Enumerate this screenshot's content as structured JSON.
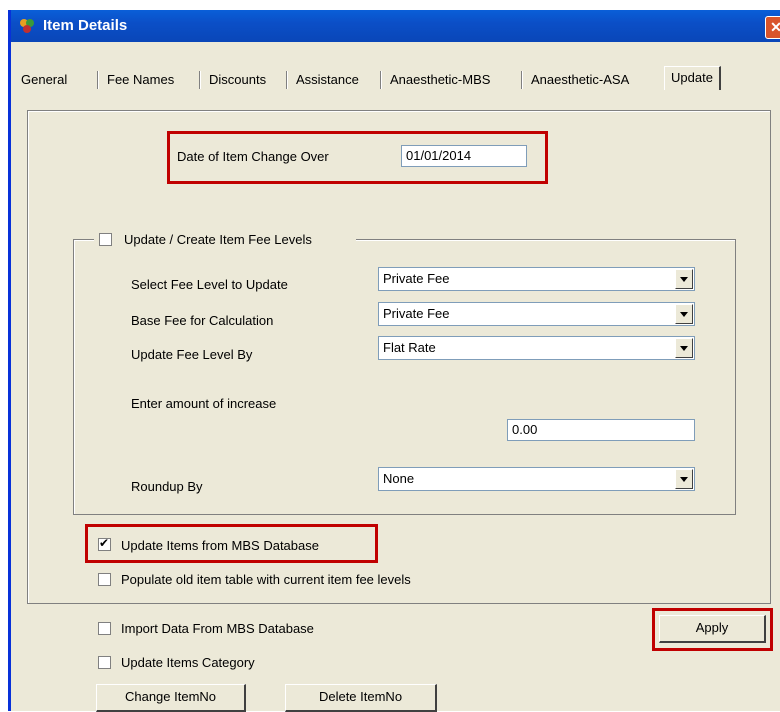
{
  "window": {
    "title": "Item Details",
    "close_glyph": "✕"
  },
  "tabs": [
    "General",
    "Fee Names",
    "Discounts",
    "Assistance",
    "Anaesthetic-MBS",
    "Anaesthetic-ASA",
    "Update"
  ],
  "active_tab": "Update",
  "changeover": {
    "label": "Date of Item Change Over",
    "value": "01/01/2014"
  },
  "fee_levels_group": {
    "title": "Update / Create Item Fee Levels",
    "checked": false,
    "select_fee_level": {
      "label": "Select Fee Level to Update",
      "value": "Private Fee"
    },
    "base_fee": {
      "label": "Base Fee for Calculation",
      "value": "Private Fee"
    },
    "update_by": {
      "label": "Update Fee Level By",
      "value": "Flat Rate"
    },
    "increase": {
      "label": "Enter amount of increase",
      "value": "0.00"
    },
    "roundup": {
      "label": "Roundup By",
      "value": "None"
    }
  },
  "options": {
    "update_mbs": {
      "label": "Update Items from MBS Database",
      "checked": true
    },
    "populate_old": {
      "label": "Populate old item table with current item fee levels",
      "checked": false
    },
    "import_mbs": {
      "label": "Import Data From MBS Database",
      "checked": false
    },
    "update_category": {
      "label": "Update Items Category",
      "checked": false
    }
  },
  "buttons": {
    "apply": "Apply",
    "change_itemno": "Change ItemNo",
    "delete_itemno": "Delete ItemNo"
  },
  "colors": {
    "highlight": "#c00000",
    "titlebar": "#0b4fc7"
  }
}
